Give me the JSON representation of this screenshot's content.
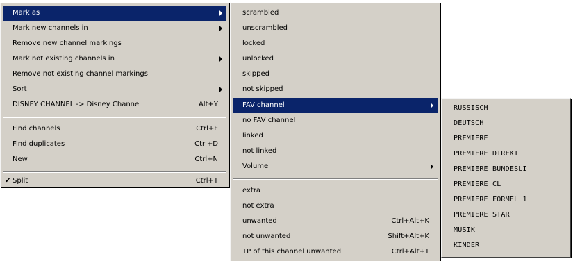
{
  "menu_main": {
    "items": [
      {
        "label": "Mark as",
        "shortcut": "",
        "has_submenu": true,
        "highlighted": true
      },
      {
        "label": "Mark new channels in",
        "shortcut": "",
        "has_submenu": true
      },
      {
        "label": "Remove new channel markings",
        "shortcut": ""
      },
      {
        "label": "Mark not existing channels in",
        "shortcut": "",
        "has_submenu": true
      },
      {
        "label": "Remove not existing channel markings",
        "shortcut": ""
      },
      {
        "label": "Sort",
        "shortcut": "",
        "has_submenu": true
      },
      {
        "label": "DISNEY CHANNEL -> Disney Channel",
        "shortcut": "Alt+Y"
      },
      {
        "label": "Find channels",
        "shortcut": "Ctrl+F"
      },
      {
        "label": "Find duplicates",
        "shortcut": "Ctrl+D"
      },
      {
        "label": "New",
        "shortcut": "Ctrl+N"
      },
      {
        "label": "Split",
        "shortcut": "Ctrl+T",
        "checked": true
      }
    ],
    "check_glyph": "✔"
  },
  "menu_mark_as": {
    "items": [
      {
        "label": "scrambled",
        "shortcut": ""
      },
      {
        "label": "unscrambled",
        "shortcut": ""
      },
      {
        "label": "locked",
        "shortcut": ""
      },
      {
        "label": "unlocked",
        "shortcut": ""
      },
      {
        "label": "skipped",
        "shortcut": ""
      },
      {
        "label": "not skipped",
        "shortcut": ""
      },
      {
        "label": "FAV channel",
        "shortcut": "",
        "has_submenu": true,
        "highlighted": true
      },
      {
        "label": "no FAV channel",
        "shortcut": ""
      },
      {
        "label": "linked",
        "shortcut": ""
      },
      {
        "label": "not linked",
        "shortcut": ""
      },
      {
        "label": "Volume",
        "shortcut": "",
        "has_submenu": true
      },
      {
        "label": "extra",
        "shortcut": ""
      },
      {
        "label": "not extra",
        "shortcut": ""
      },
      {
        "label": "unwanted",
        "shortcut": "Ctrl+Alt+K"
      },
      {
        "label": "not unwanted",
        "shortcut": "Shift+Alt+K"
      },
      {
        "label": "TP of this channel unwanted",
        "shortcut": "Ctrl+Alt+T"
      }
    ]
  },
  "menu_fav": {
    "items": [
      {
        "label": "RUSSISCH"
      },
      {
        "label": "DEUTSCH"
      },
      {
        "label": "PREMIERE"
      },
      {
        "label": "PREMIERE DIREKT"
      },
      {
        "label": "PREMIERE BUNDESLI"
      },
      {
        "label": "PREMIERE CL"
      },
      {
        "label": "PREMIERE FORMEL 1"
      },
      {
        "label": "PREMIERE STAR"
      },
      {
        "label": "MUSIK"
      },
      {
        "label": "KINDER"
      }
    ]
  },
  "colors": {
    "menu_bg": "#d4d0c8",
    "highlight_bg": "#0a246a",
    "highlight_text": "#ffffff"
  }
}
